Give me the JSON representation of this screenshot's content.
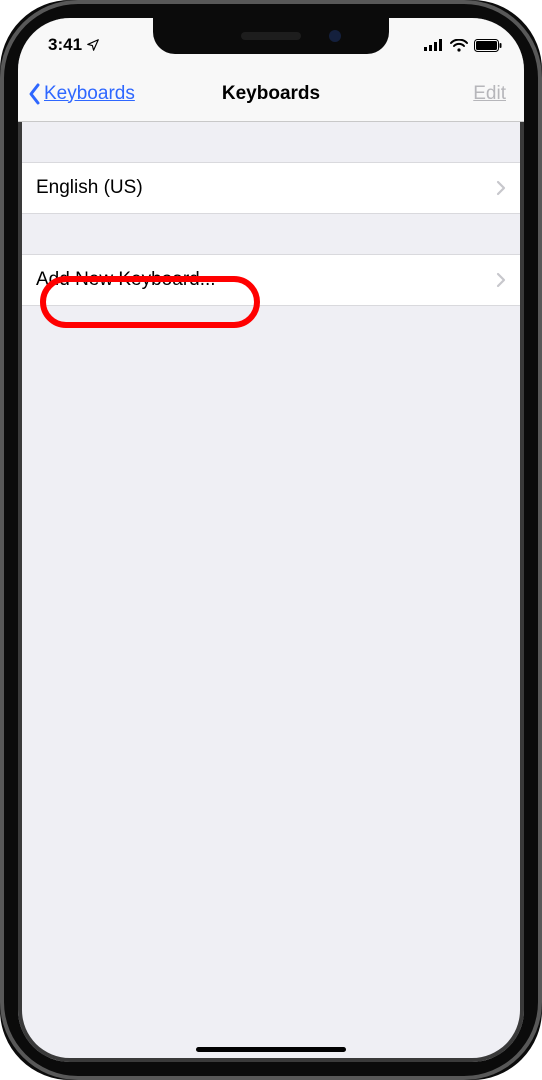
{
  "status": {
    "time": "3:41",
    "locationIcon": "location-arrow"
  },
  "nav": {
    "backLabel": "Keyboards",
    "title": "Keyboards",
    "editLabel": "Edit"
  },
  "keyboards": [
    {
      "label": "English (US)"
    }
  ],
  "addNewLabel": "Add New Keyboard..."
}
